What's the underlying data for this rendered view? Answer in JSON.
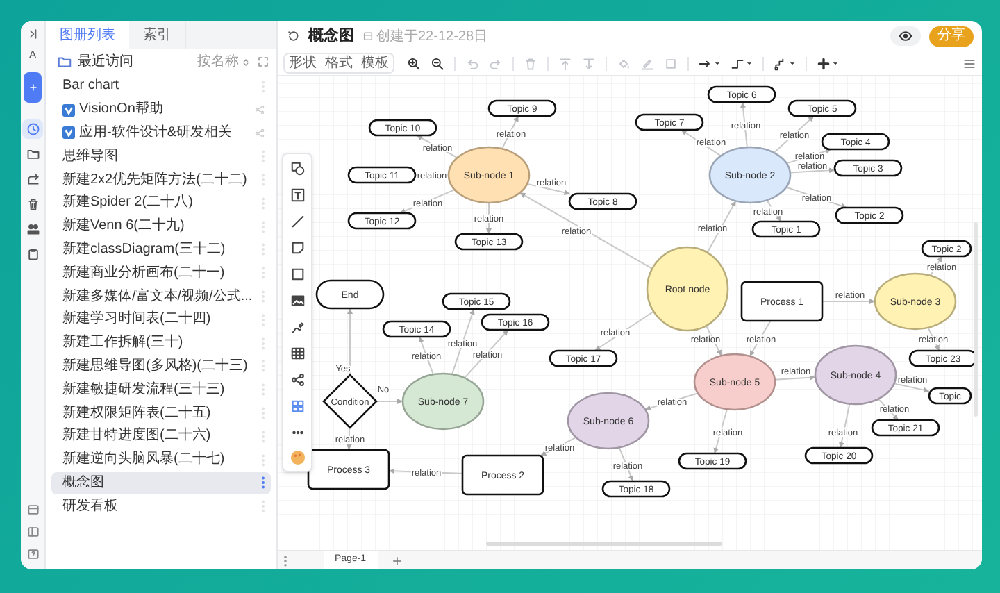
{
  "rail": {
    "letter": "A",
    "items": [
      {
        "kind": "recent",
        "selected": true
      },
      {
        "kind": "folder",
        "selected": false
      },
      {
        "kind": "share",
        "selected": false
      },
      {
        "kind": "trash",
        "selected": false
      },
      {
        "kind": "team",
        "selected": false
      },
      {
        "kind": "clipboard",
        "selected": false
      }
    ]
  },
  "sidebar": {
    "tabs": [
      {
        "label": "图册列表",
        "selected": true
      },
      {
        "label": "索引",
        "selected": false
      }
    ],
    "section": "最近访问",
    "sort": "按名称",
    "items": [
      {
        "label": "Bar chart",
        "kind": "file",
        "selected": false
      },
      {
        "label": "VisionOn帮助",
        "kind": "linked",
        "selected": false
      },
      {
        "label": "应用-软件设计&研发相关",
        "kind": "linked",
        "selected": false
      },
      {
        "label": "思维导图",
        "kind": "file",
        "selected": false
      },
      {
        "label": "新建2x2优先矩阵方法(二十二)",
        "kind": "file",
        "selected": false
      },
      {
        "label": "新建Spider 2(二十八)",
        "kind": "file",
        "selected": false
      },
      {
        "label": "新建Venn 6(二十九)",
        "kind": "file",
        "selected": false
      },
      {
        "label": "新建classDiagram(三十二)",
        "kind": "file",
        "selected": false
      },
      {
        "label": "新建商业分析画布(二十一)",
        "kind": "file",
        "selected": false
      },
      {
        "label": "新建多媒体/富文本/视频/公式...",
        "kind": "file",
        "selected": false
      },
      {
        "label": "新建学习时间表(二十四)",
        "kind": "file",
        "selected": false
      },
      {
        "label": "新建工作拆解(三十)",
        "kind": "file",
        "selected": false
      },
      {
        "label": "新建思维导图(多风格)(二十三)",
        "kind": "file",
        "selected": false
      },
      {
        "label": "新建敏捷研发流程(三十三)",
        "kind": "file",
        "selected": false
      },
      {
        "label": "新建权限矩阵表(二十五)",
        "kind": "file",
        "selected": false
      },
      {
        "label": "新建甘特进度图(二十六)",
        "kind": "file",
        "selected": false
      },
      {
        "label": "新建逆向头脑风暴(二十七)",
        "kind": "file",
        "selected": false
      },
      {
        "label": "概念图",
        "kind": "file",
        "selected": true
      },
      {
        "label": "研发看板",
        "kind": "file",
        "selected": false
      }
    ]
  },
  "document": {
    "title": "概念图",
    "created": "创建于22-12-28日",
    "share_button": "分享"
  },
  "toolbar": {
    "tabs": [
      {
        "label": "形状"
      },
      {
        "label": "格式"
      },
      {
        "label": "模板"
      }
    ],
    "tools": [
      {
        "kind": "zoom_in",
        "disabled": false
      },
      {
        "kind": "zoom_out",
        "disabled": false
      },
      {
        "kind": "undo",
        "disabled": true
      },
      {
        "kind": "redo",
        "disabled": true
      },
      {
        "kind": "delete",
        "disabled": true
      },
      {
        "kind": "to_front",
        "disabled": true
      },
      {
        "kind": "to_back",
        "disabled": true
      },
      {
        "kind": "fill",
        "disabled": true
      },
      {
        "kind": "line",
        "disabled": true
      },
      {
        "kind": "shadow",
        "disabled": true
      },
      {
        "kind": "connector",
        "disabled": false
      },
      {
        "kind": "waypoints",
        "disabled": false
      },
      {
        "kind": "arrange",
        "disabled": false
      },
      {
        "kind": "insert",
        "disabled": false
      }
    ]
  },
  "diagram": {
    "nodes": [
      {
        "kind": "topic",
        "text": "Topic 6"
      },
      {
        "kind": "topic",
        "text": "Topic 9"
      },
      {
        "kind": "topic",
        "text": "Topic 5"
      },
      {
        "kind": "topic",
        "text": "Topic 7"
      },
      {
        "kind": "topic",
        "text": "Topic 10"
      },
      {
        "kind": "topic",
        "text": "Topic 4"
      },
      {
        "kind": "topic",
        "text": "Topic 3"
      },
      {
        "kind": "topic",
        "text": "Topic 11"
      },
      {
        "kind": "ellipse",
        "text": "Sub-node 1",
        "color": "#ffe0b3"
      },
      {
        "kind": "ellipse",
        "text": "Sub-node 2",
        "color": "#dae8fc"
      },
      {
        "kind": "topic",
        "text": "Topic 8"
      },
      {
        "kind": "topic",
        "text": "Topic 2"
      },
      {
        "kind": "topic",
        "text": "Topic 12"
      },
      {
        "kind": "topic",
        "text": "Topic 1"
      },
      {
        "kind": "topic",
        "text": "Topic 13"
      },
      {
        "kind": "topic",
        "text": "Topic 2"
      },
      {
        "kind": "ellipse",
        "text": "Root node",
        "color": "#fff2b3"
      },
      {
        "kind": "terminal",
        "text": "End"
      },
      {
        "kind": "topic",
        "text": "Topic 15"
      },
      {
        "kind": "process",
        "text": "Process 1"
      },
      {
        "kind": "ellipse",
        "text": "Sub-node 3",
        "color": "#fff2b3"
      },
      {
        "kind": "topic",
        "text": "Topic 16"
      },
      {
        "kind": "topic",
        "text": "Topic 14"
      },
      {
        "kind": "topic",
        "text": "Topic 17"
      },
      {
        "kind": "topic",
        "text": "Topic 23"
      },
      {
        "kind": "ellipse",
        "text": "Sub-node 4",
        "color": "#e1d5e7"
      },
      {
        "kind": "ellipse",
        "text": "Sub-node 5",
        "color": "#f8cecc"
      },
      {
        "kind": "topic",
        "text": "Topic"
      },
      {
        "kind": "decision",
        "text": "Condition"
      },
      {
        "kind": "ellipse",
        "text": "Sub-node 7",
        "color": "#d5e8d4"
      },
      {
        "kind": "ellipse",
        "text": "Sub-node 6",
        "color": "#e1d5e7"
      },
      {
        "kind": "topic",
        "text": "Topic 21"
      },
      {
        "kind": "topic",
        "text": "Topic 20"
      },
      {
        "kind": "topic",
        "text": "Topic 19"
      },
      {
        "kind": "process",
        "text": "Process 3"
      },
      {
        "kind": "process",
        "text": "Process 2"
      },
      {
        "kind": "topic",
        "text": "Topic 18"
      }
    ],
    "edges": [
      {
        "label": "relation"
      },
      {
        "label": "relation"
      },
      {
        "label": "relation"
      },
      {
        "label": "relation"
      },
      {
        "label": "relation"
      },
      {
        "label": "relation"
      },
      {
        "label": "relation"
      },
      {
        "label": "relation"
      },
      {
        "label": "relation"
      },
      {
        "label": "relation"
      },
      {
        "label": "relation"
      },
      {
        "label": "relation"
      },
      {
        "label": "relation"
      },
      {
        "label": "relation"
      },
      {
        "label": "relation"
      },
      {
        "label": "relation"
      },
      {
        "label": "relation"
      },
      {
        "label": "relation"
      },
      {
        "label": "relation"
      },
      {
        "label": "relation"
      },
      {
        "label": "relation"
      },
      {
        "label": "relation"
      },
      {
        "label": "relation"
      },
      {
        "label": "relation"
      },
      {
        "label": "Yes"
      },
      {
        "label": "relation"
      },
      {
        "label": "relation"
      },
      {
        "label": "No"
      },
      {
        "label": "relation"
      },
      {
        "label": "relation"
      },
      {
        "label": "relation"
      },
      {
        "label": "relation"
      },
      {
        "label": "relation"
      },
      {
        "label": "relation"
      },
      {
        "label": "relation"
      },
      {
        "label": "relation"
      }
    ]
  },
  "pages": [
    {
      "label": "Page-1",
      "selected": true
    }
  ]
}
